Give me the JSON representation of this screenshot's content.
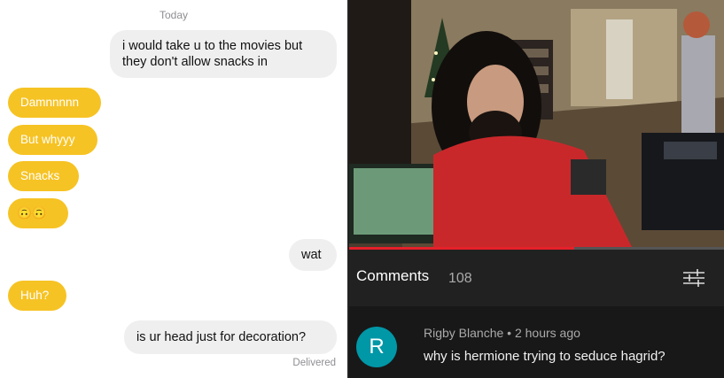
{
  "chat": {
    "day_label": "Today",
    "messages": [
      {
        "from": "me",
        "text": "i would take u to the movies but they don't allow snacks in"
      },
      {
        "from": "them",
        "text": "Damnnnnn"
      },
      {
        "from": "them",
        "text": "But whyyy"
      },
      {
        "from": "them",
        "text": "Snacks"
      },
      {
        "from": "them",
        "text": "🙃🙃"
      },
      {
        "from": "me",
        "text": "wat"
      },
      {
        "from": "them",
        "text": "Huh?"
      },
      {
        "from": "me",
        "text": "is ur head just for decoration?"
      }
    ],
    "status": "Delivered",
    "colors": {
      "incoming": "#f6c324",
      "outgoing": "#efefef"
    }
  },
  "video": {
    "progress": 0.6,
    "colors": {
      "progress": "#e5202a"
    }
  },
  "comments": {
    "title": "Comments",
    "count": "108",
    "filter_icon": "sort-filter-icon",
    "items": [
      {
        "avatar_letter": "R",
        "author": "Rigby Blanche",
        "separator": "•",
        "time": "2 hours ago",
        "text": "why is hermione trying to seduce hagrid?",
        "avatar_color": "#0097a7"
      }
    ]
  }
}
